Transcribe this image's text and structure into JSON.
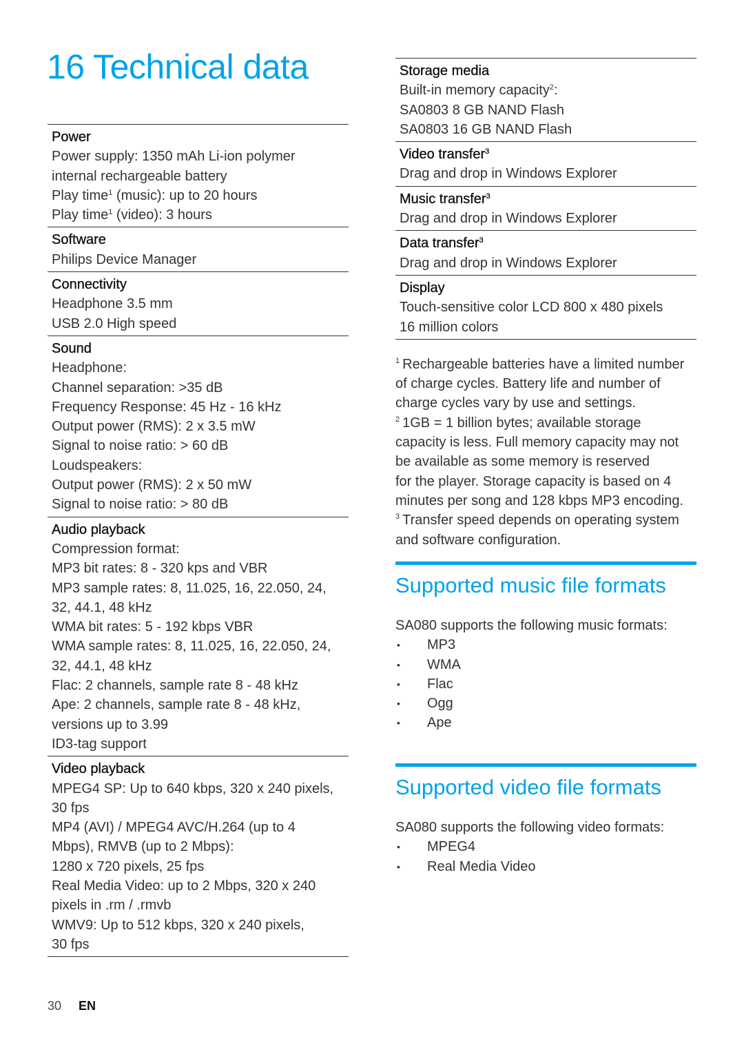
{
  "page": {
    "title": "16 Technical data",
    "accent_color": "#00a2e8",
    "page_number": "30",
    "language": "EN"
  },
  "specs_left": [
    {
      "heading": "Power",
      "lines": [
        {
          "text": "Power supply: 1350 mAh Li-ion polymer"
        },
        {
          "text": "internal rechargeable battery"
        },
        {
          "text": "Play time",
          "sup": "1",
          "rest": " (music): up to 20 hours"
        },
        {
          "text": "Play time",
          "sup": "1",
          "rest": " (video): 3 hours"
        }
      ]
    },
    {
      "heading": "Software",
      "lines": [
        {
          "text": "Philips Device Manager"
        }
      ]
    },
    {
      "heading": "Connectivity",
      "lines": [
        {
          "text": "Headphone 3.5 mm"
        },
        {
          "text": "USB 2.0 High speed"
        }
      ]
    },
    {
      "heading": "Sound",
      "lines": [
        {
          "text": "Headphone:"
        },
        {
          "text": "Channel separation: >35 dB"
        },
        {
          "text": "Frequency Response: 45 Hz - 16 kHz"
        },
        {
          "text": "Output power (RMS): 2 x 3.5 mW"
        },
        {
          "text": "Signal to noise ratio: > 60 dB"
        },
        {
          "text": "Loudspeakers:"
        },
        {
          "text": "Output power (RMS): 2 x 50 mW"
        },
        {
          "text": "Signal to noise ratio: > 80 dB"
        }
      ]
    },
    {
      "heading": "Audio playback",
      "lines": [
        {
          "text": "Compression format:"
        },
        {
          "text": "MP3 bit rates: 8 - 320 kps and VBR"
        },
        {
          "text": "MP3 sample rates: 8, 11.025, 16, 22.050, 24,"
        },
        {
          "text": "32, 44.1, 48 kHz"
        },
        {
          "text": "WMA bit rates: 5 - 192 kbps VBR"
        },
        {
          "text": "WMA sample rates: 8, 11.025, 16, 22.050, 24,"
        },
        {
          "text": "32, 44.1, 48 kHz"
        },
        {
          "text": "Flac: 2 channels, sample rate 8 - 48 kHz"
        },
        {
          "text": "Ape: 2 channels, sample rate 8 - 48 kHz,"
        },
        {
          "text": "versions up to 3.99"
        },
        {
          "text": "ID3-tag support"
        }
      ]
    },
    {
      "heading": "Video playback",
      "lines": [
        {
          "text": "MPEG4 SP: Up to 640 kbps, 320 x 240 pixels,"
        },
        {
          "text": "30 fps"
        },
        {
          "text": "MP4 (AVI) / MPEG4 AVC/H.264 (up to 4"
        },
        {
          "text": "Mbps), RMVB (up to 2 Mbps):"
        },
        {
          "text": "1280 x 720 pixels, 25 fps"
        },
        {
          "text": "Real Media Video: up to 2 Mbps, 320 x 240"
        },
        {
          "text": "pixels in .rm / .rmvb"
        },
        {
          "text": "WMV9: Up to 512 kbps, 320 x 240 pixels,"
        },
        {
          "text": "30 fps"
        }
      ]
    }
  ],
  "specs_right": [
    {
      "heading": "Storage media",
      "lines": [
        {
          "text": "Built-in memory capacity",
          "sup": "2",
          "rest": ":"
        },
        {
          "text": "SA0803 8 GB NAND Flash"
        },
        {
          "text": "SA0803 16 GB NAND Flash"
        }
      ]
    },
    {
      "heading": "Video transfer",
      "heading_sup": "3",
      "lines": [
        {
          "text": "Drag and drop in Windows Explorer"
        }
      ]
    },
    {
      "heading": "Music transfer",
      "heading_sup": "3",
      "lines": [
        {
          "text": "Drag and drop in Windows Explorer"
        }
      ]
    },
    {
      "heading": "Data transfer",
      "heading_sup": "3",
      "lines": [
        {
          "text": "Drag and drop in Windows Explorer"
        }
      ]
    },
    {
      "heading": "Display",
      "lines": [
        {
          "text": "Touch-sensitive color LCD 800 x 480 pixels"
        },
        {
          "text": "16 million colors"
        }
      ]
    }
  ],
  "footnotes": [
    {
      "mark": "1",
      "lines": [
        "Rechargeable batteries have a limited number",
        "of charge cycles. Battery life and number of",
        "charge cycles vary by use and settings."
      ]
    },
    {
      "mark": "2",
      "lines": [
        "1GB = 1 billion bytes; available storage",
        "capacity is less. Full memory capacity may not",
        "be available as some memory is reserved",
        "for the player. Storage capacity is based on 4",
        "minutes per song and 128 kbps MP3 encoding."
      ]
    },
    {
      "mark": "3",
      "lines": [
        "Transfer speed depends on operating system",
        "and software configuration."
      ]
    }
  ],
  "music_formats": {
    "title": "Supported music file formats",
    "intro": "SA080 supports the following music formats:",
    "items": [
      "MP3",
      "WMA",
      "Flac",
      "Ogg",
      "Ape"
    ]
  },
  "video_formats": {
    "title": "Supported video file formats",
    "intro": "SA080 supports the following video formats:",
    "items": [
      "MPEG4",
      "Real Media Video"
    ]
  },
  "bullet_glyph": "•"
}
